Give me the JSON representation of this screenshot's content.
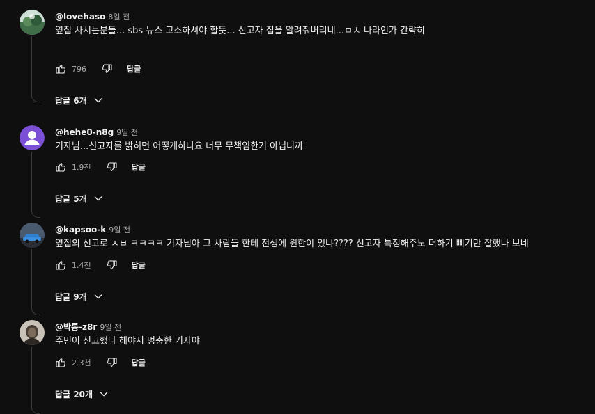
{
  "comments": [
    {
      "author": "@lovehaso",
      "time": "8일 전",
      "text": "옆집 사시는분들... sbs 뉴스 고소하셔야 할듯...    신고자 집을 알려줘버리네...ㅁㅊ 나라인가 간략히",
      "likes": "796",
      "reply_label": "답글",
      "replies_label": "답글 6개",
      "avatar": "landscape-avatar"
    },
    {
      "author": "@hehe0-n8g",
      "time": "9일 전",
      "text": "기자님...신고자를 밝히면 어떻게하나요 너무 무책임한거 아닙니까",
      "likes": "1.9천",
      "reply_label": "답글",
      "replies_label": "답글 5개",
      "avatar": "default-person-avatar"
    },
    {
      "author": "@kapsoo-k",
      "time": "9일 전",
      "text": "옆집의 신고로  ㅅㅂ  ㅋㅋㅋㅋ 기자님아 그 사람들 한테 전생에 원한이 있냐???? 신고자 특정해주노 더하기 삐기만 잘했나 보네",
      "likes": "1.4천",
      "reply_label": "답글",
      "replies_label": "답글 9개",
      "avatar": "car-avatar"
    },
    {
      "author": "@박통-z8r",
      "time": "9일 전",
      "text": "주민이 신고했다 해야지 멍충한 기자야",
      "likes": "2.3천",
      "reply_label": "답글",
      "replies_label": "답글 20개",
      "avatar": "portrait-avatar"
    }
  ],
  "icons": {
    "like": "thumbs-up-icon",
    "dislike": "thumbs-down-icon",
    "expand": "chevron-down-icon"
  },
  "colors": {
    "background": "#0f0f0f",
    "text": "#f1f1f1",
    "secondary_text": "#aaaaaa",
    "default_avatar": "#7b4fd6"
  }
}
